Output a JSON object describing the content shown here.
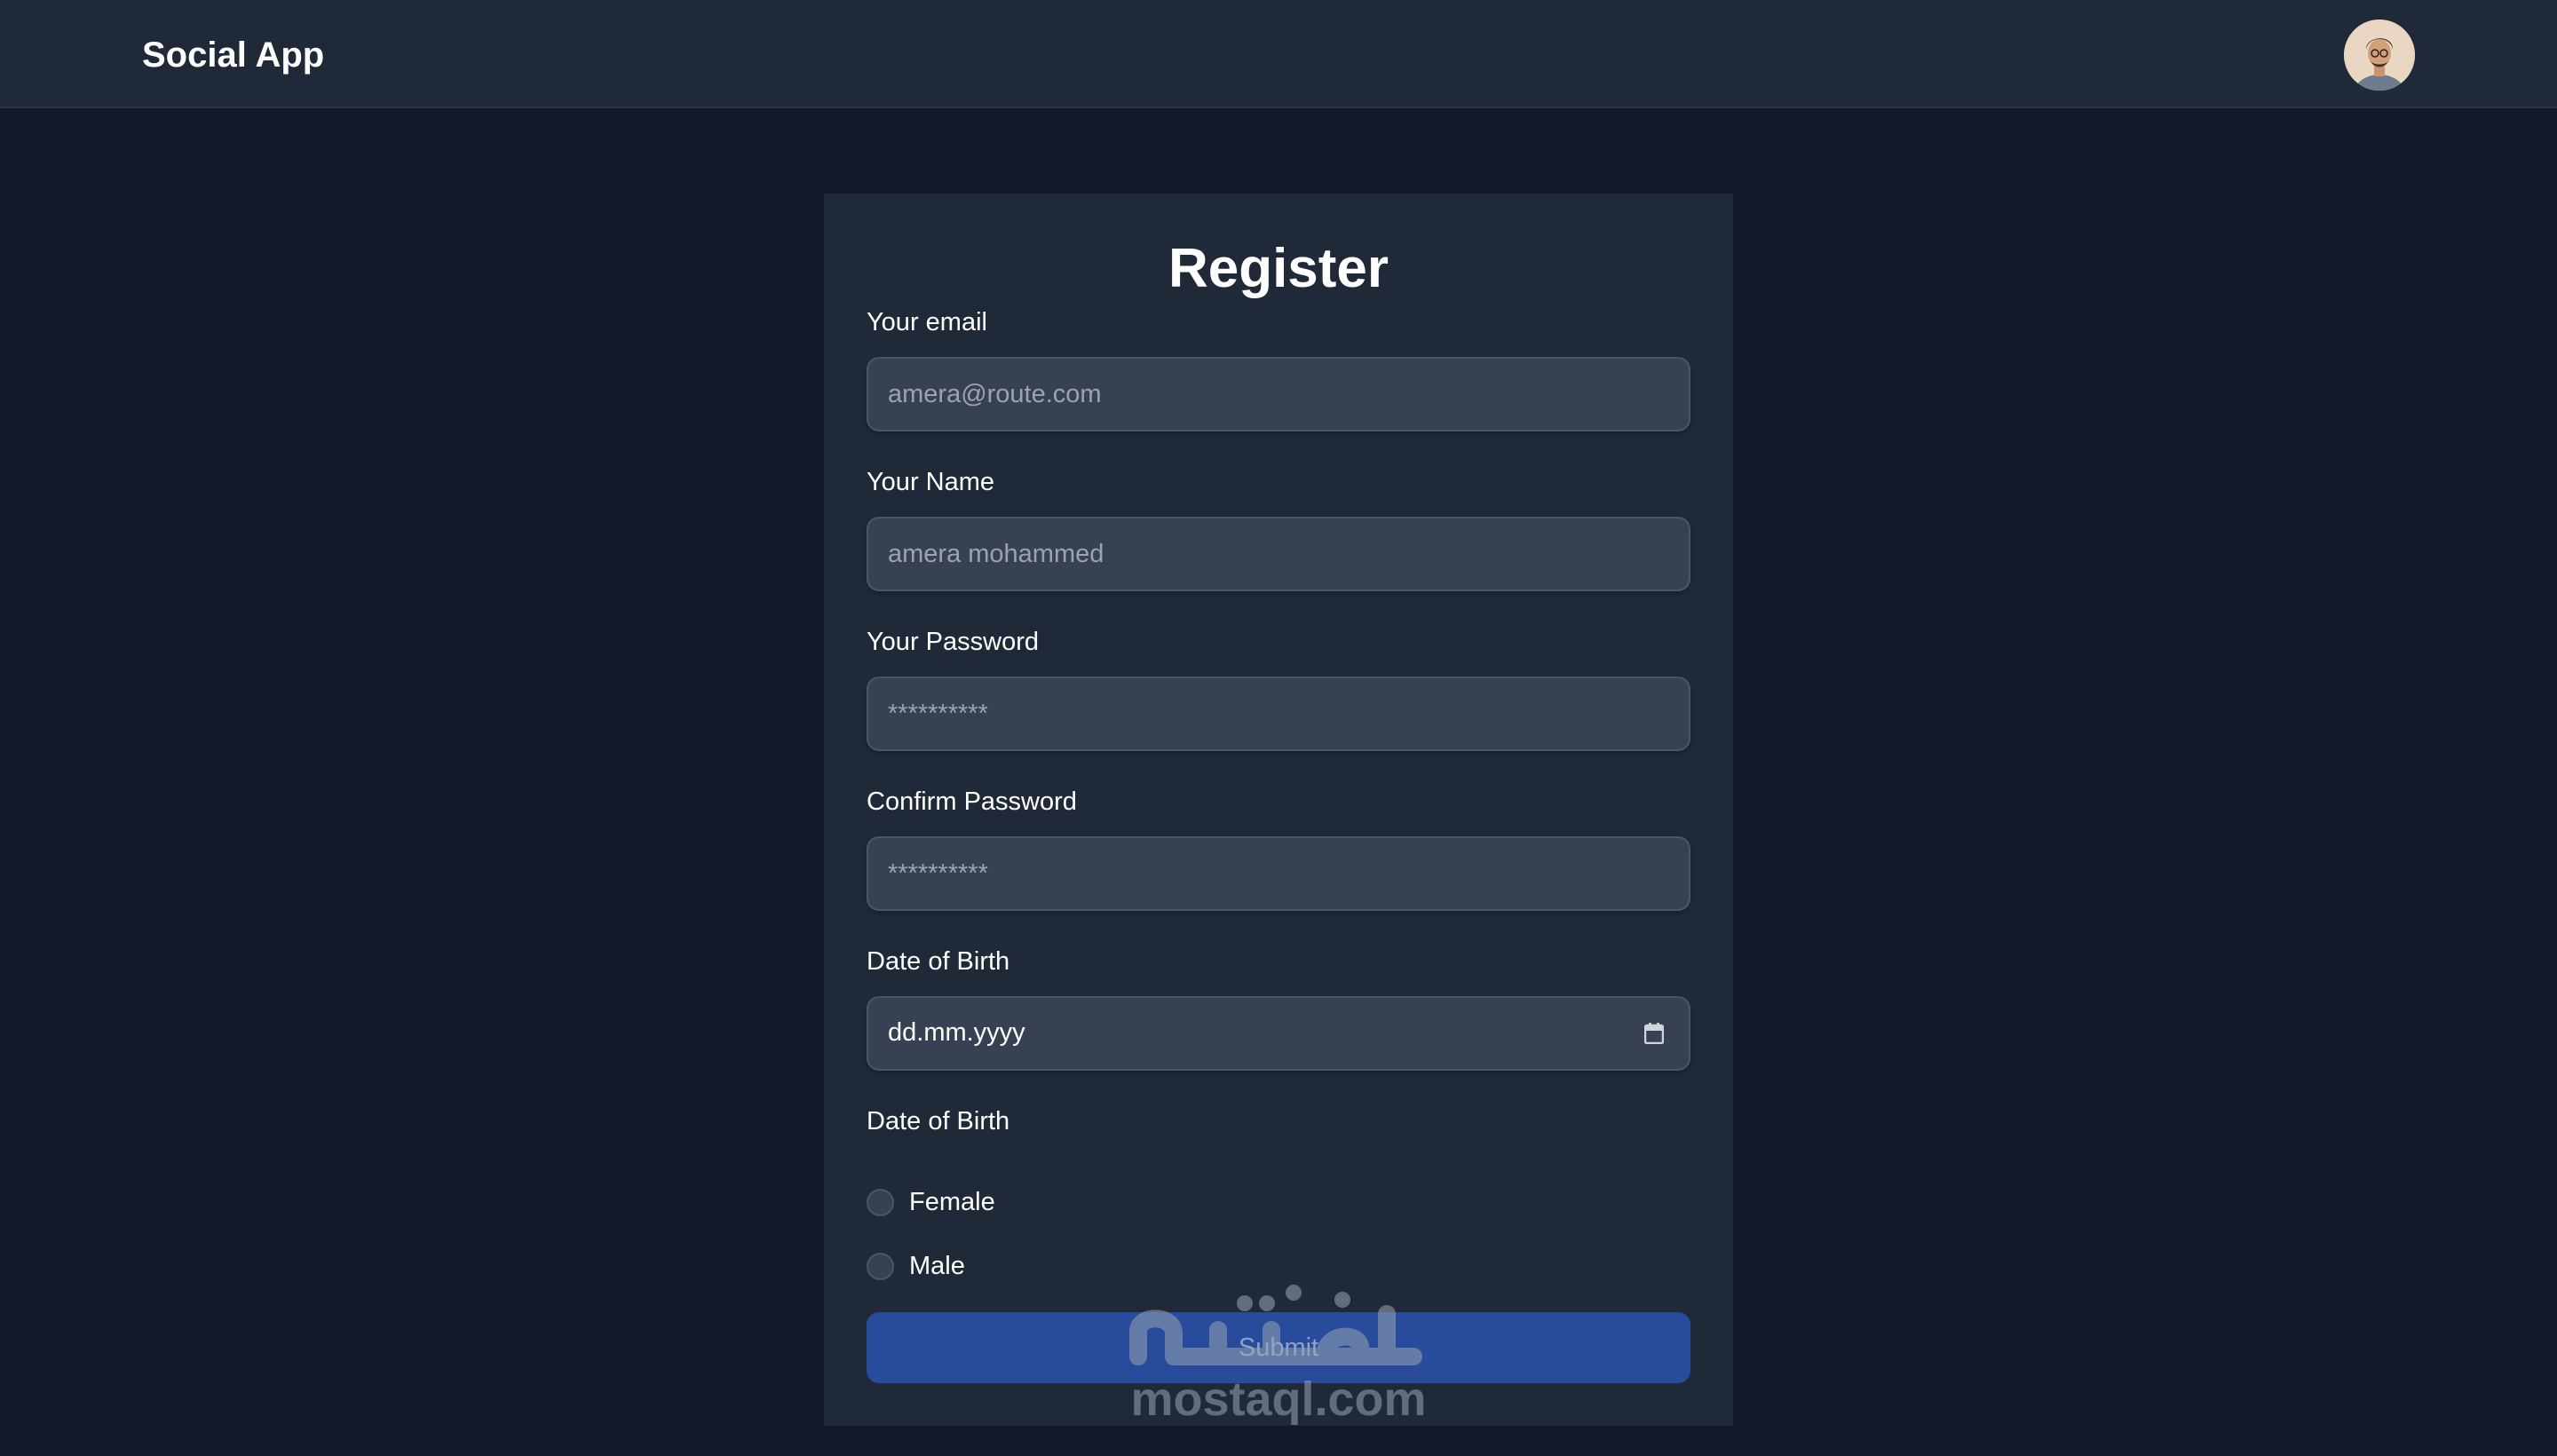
{
  "header": {
    "brand": "Social App"
  },
  "form": {
    "title": "Register",
    "email": {
      "label": "Your email",
      "placeholder": "amera@route.com"
    },
    "name": {
      "label": "Your Name",
      "placeholder": "amera mohammed"
    },
    "password": {
      "label": "Your Password",
      "placeholder": "**********"
    },
    "confirm_password": {
      "label": "Confirm Password",
      "placeholder": "**********"
    },
    "dob": {
      "label": "Date of Birth",
      "format_text": "dd.mm.yyyy"
    },
    "gender": {
      "label": "Date of Birth",
      "options": [
        "Female",
        "Male"
      ]
    },
    "submit_label": "Submit"
  },
  "watermark": {
    "text": "mostaql.com"
  },
  "colors": {
    "page_bg": "#111827",
    "surface": "#1f2937",
    "input_bg": "#374151",
    "input_border": "#4b5563",
    "button": "#284b9b"
  }
}
